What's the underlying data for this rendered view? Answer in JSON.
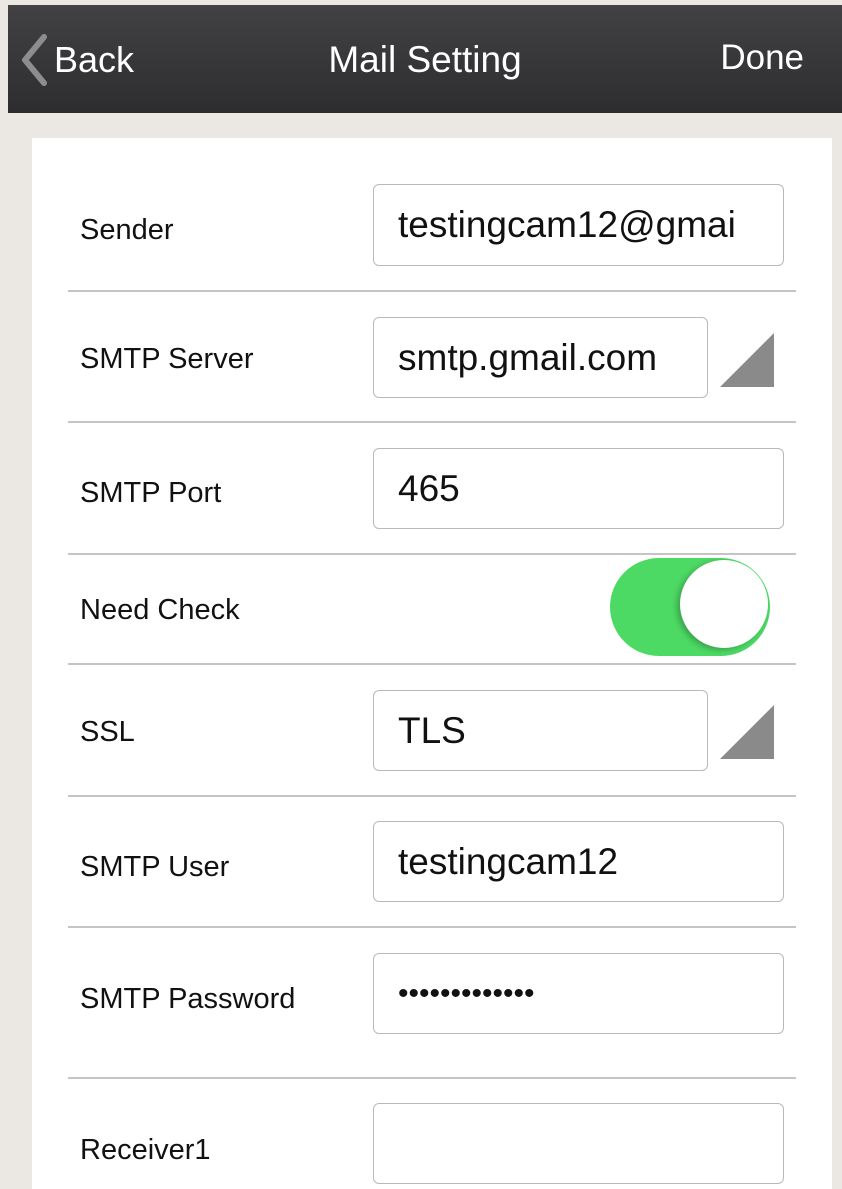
{
  "nav": {
    "back_label": "Back",
    "title": "Mail Setting",
    "done_label": "Done"
  },
  "form": {
    "sender": {
      "label": "Sender",
      "value": "testingcam12@gmai"
    },
    "smtp_server": {
      "label": "SMTP Server",
      "value": "smtp.gmail.com"
    },
    "smtp_port": {
      "label": "SMTP Port",
      "value": "465"
    },
    "need_check": {
      "label": "Need Check",
      "on": true
    },
    "ssl": {
      "label": "SSL",
      "value": "TLS"
    },
    "smtp_user": {
      "label": "SMTP User",
      "value": "testingcam12"
    },
    "smtp_password": {
      "label": "SMTP Password",
      "value": "•••••••••••••"
    },
    "receiver1": {
      "label": "Receiver1",
      "value": ""
    }
  },
  "colors": {
    "nav_background": "#333335",
    "page_background": "#ebe8e4",
    "toggle_on": "#4cd964",
    "arrow_gray": "#8a8a8a"
  },
  "icons": {
    "back": "chevron-left-icon",
    "dropdown": "dropdown-triangle-icon"
  }
}
